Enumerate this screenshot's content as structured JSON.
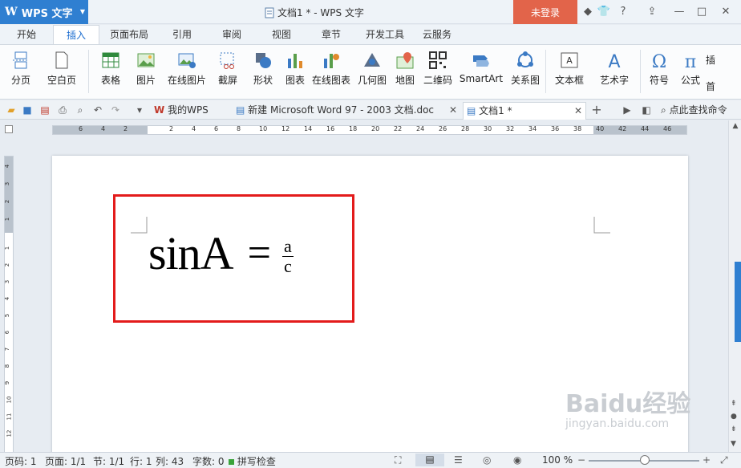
{
  "app": {
    "name": "WPS 文字",
    "logo": "W"
  },
  "window": {
    "title": "文档1 * - WPS 文字",
    "login_label": "未登录"
  },
  "ribbon_tabs": [
    "开始",
    "插入",
    "页面布局",
    "引用",
    "审阅",
    "视图",
    "章节",
    "开发工具",
    "云服务"
  ],
  "active_tab": "插入",
  "ribbon": {
    "page_break": "分页",
    "blank_page": "空白页",
    "table": "表格",
    "picture": "图片",
    "online_picture": "在线图片",
    "screenshot": "截屏",
    "shape": "形状",
    "chart": "图表",
    "online_chart": "在线图表",
    "geometry": "几何图",
    "map": "地图",
    "qrcode": "二维码",
    "smartart": "SmartArt",
    "relation": "关系图",
    "textbox": "文本框",
    "wordart": "艺术字",
    "symbol": "符号",
    "formula": "公式",
    "more1": "插",
    "more2": "首"
  },
  "doc_tabs": [
    {
      "label": "我的WPS"
    },
    {
      "label": "新建 Microsoft Word 97 - 2003 文档.doc"
    },
    {
      "label": "文档1 *"
    }
  ],
  "search": {
    "label": "点此查找命令"
  },
  "ruler": {
    "h_numbers": [
      "6",
      "4",
      "2",
      "2",
      "4",
      "6",
      "8",
      "10",
      "12",
      "14",
      "16",
      "18",
      "20",
      "22",
      "24",
      "26",
      "28",
      "30",
      "32",
      "34",
      "36",
      "38",
      "40",
      "42",
      "44",
      "46"
    ],
    "v_numbers": [
      "4",
      "3",
      "2",
      "1",
      "1",
      "2",
      "3",
      "4",
      "5",
      "6",
      "7",
      "8",
      "9",
      "10",
      "11",
      "12"
    ]
  },
  "document": {
    "formula_main": "sinA",
    "formula_eq": "=",
    "numerator": "a",
    "denominator": "c"
  },
  "status": {
    "page_no": "页码: 1",
    "pages": "页面: 1/1",
    "section": "节: 1/1",
    "row": "行: 1",
    "col": "列: 43",
    "words": "字数: 0",
    "spell": "拼写检查",
    "zoom": "100 %"
  },
  "watermark": {
    "text1": "Baidu",
    "text2": "经验",
    "url": "jingyan.baidu.com"
  },
  "colors": {
    "accent": "#2f7fd1",
    "login": "#e2644a",
    "highlight": "#e31b1b"
  }
}
